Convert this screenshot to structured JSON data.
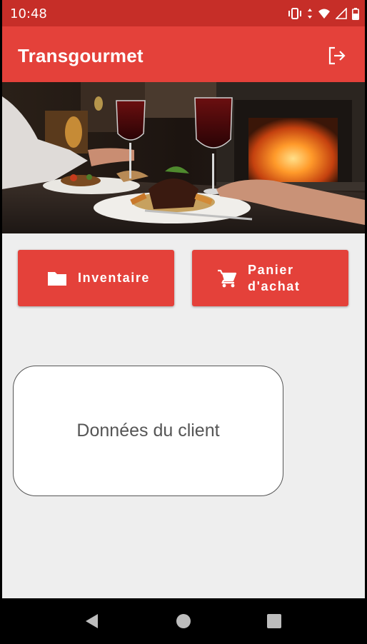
{
  "status_bar": {
    "time": "10:48",
    "icons": [
      "vibrate-icon",
      "data-arrows-icon",
      "wifi-icon",
      "cell-signal-icon",
      "battery-icon"
    ]
  },
  "app_bar": {
    "title": "Transgourmet",
    "logout_icon": "logout-icon"
  },
  "hero": {
    "description_icon": "restaurant-dinner-photo"
  },
  "actions": {
    "inventaire": {
      "label": "Inventaire",
      "icon": "folder-icon"
    },
    "panier": {
      "label": "Panier\nd'achat",
      "icon": "cart-icon"
    }
  },
  "client_card": {
    "label": "Données du client"
  },
  "nav_bar": {
    "icons": [
      "back-icon",
      "home-icon",
      "recents-icon"
    ]
  },
  "colors": {
    "primary": "#e4413a",
    "primary_dark": "#c62e28",
    "background": "#eeeeee"
  }
}
